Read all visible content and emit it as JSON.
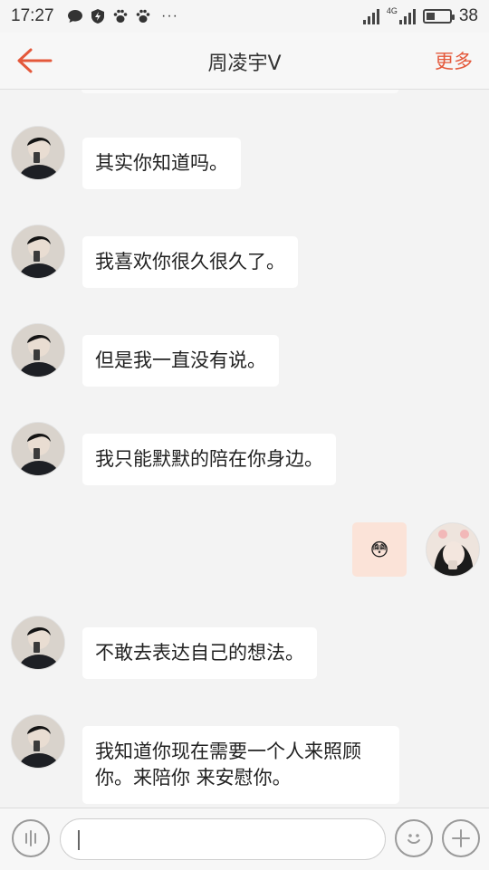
{
  "status_bar": {
    "time": "17:27",
    "network_type": "4G",
    "battery_percent": "38",
    "battery_level": 0.38,
    "notification_icons": [
      "chat-bubble-icon",
      "shield-icon",
      "paw-icon",
      "paw-icon"
    ],
    "overflow": "···"
  },
  "header": {
    "title": "周凌宇V",
    "more_label": "更多",
    "accent_color": "#e4583b"
  },
  "messages": [
    {
      "from": "other",
      "text": "其实你知道吗。"
    },
    {
      "from": "other",
      "text": "我喜欢你很久很久了。"
    },
    {
      "from": "other",
      "text": "但是我一直没有说。"
    },
    {
      "from": "other",
      "text": "我只能默默的陪在你身边。"
    },
    {
      "from": "self",
      "text": "😳"
    },
    {
      "from": "other",
      "text": "不敢去表达自己的想法。"
    },
    {
      "from": "other",
      "text": "我知道你现在需要一个人来照顾你。来陪你 来安慰你。"
    }
  ],
  "input_bar": {
    "placeholder": "",
    "voice_icon": "voice-icon",
    "emoji_icon": "emoji-icon",
    "add_icon": "plus-icon"
  }
}
